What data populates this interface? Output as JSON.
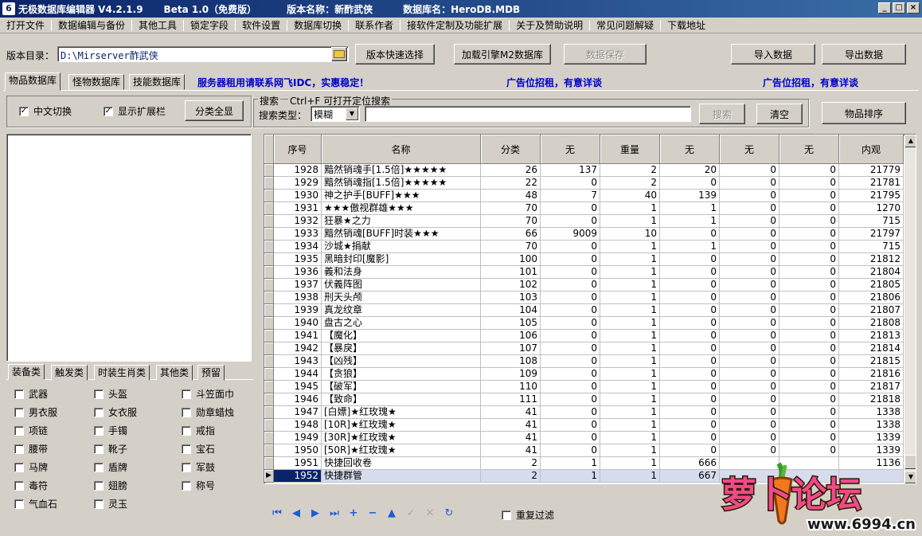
{
  "title_bar": {
    "app": "无极数据库编辑器 V4.2.1.9",
    "edition": "Beta 1.0（免费版）",
    "version_label": "版本名称：新酢武侠",
    "db_label": "数据库名：HeroDB.MDB",
    "buttons": [
      "_",
      "□",
      "×"
    ]
  },
  "menu": [
    "打开文件",
    "数据编辑与备份",
    "其他工具",
    "锁定字段",
    "软件设置",
    "数据库切换",
    "联系作者",
    "接软件定制及功能扩展",
    "关于及赞助说明",
    "常见问题解疑",
    "下载地址"
  ],
  "toolbar": {
    "dir_label": "版本目录：",
    "dir_value": "D:\\Mirserver酢武侠",
    "quick_select": "版本快速选择",
    "load_m2": "加载引擎M2数据库",
    "save": "数据保存",
    "import": "导入数据",
    "export": "导出数据"
  },
  "tabs": [
    "物品数据库",
    "怪物数据库",
    "技能数据库"
  ],
  "ads": {
    "server": "服务器租用请联系网飞IDC，实惠稳定！",
    "ad1": "广告位招租，有意详谈",
    "ad2": "广告位招租，有意详谈"
  },
  "options": {
    "chinese": "中文切换",
    "ext": "显示扩展栏",
    "show_all": "分类全显"
  },
  "search": {
    "title": "搜索",
    "hint": "Ctrl+F 可打开定位搜索",
    "type_label": "搜索类型：",
    "type_value": "模糊",
    "search_btn": "搜索",
    "clear_btn": "清空",
    "sort_btn": "物品排序"
  },
  "category_tabs": [
    "装备类",
    "触发类",
    "时装生肖类",
    "其他类",
    "预留"
  ],
  "categories": [
    "武器",
    "头盔",
    "斗笠面巾",
    "男衣服",
    "女衣服",
    "勋章蜡烛",
    "项链",
    "手镯",
    "戒指",
    "腰带",
    "靴子",
    "宝石",
    "马牌",
    "盾牌",
    "军鼓",
    "毒符",
    "翅膀",
    "称号",
    "气血石",
    "灵玉"
  ],
  "grid": {
    "columns": [
      "序号",
      "名称",
      "分类",
      "无",
      "重量",
      "无",
      "无",
      "无",
      "内观"
    ],
    "rows": [
      [
        "1928",
        "黯然销魂手[1.5倍]★★★★★",
        "26",
        "137",
        "2",
        "20",
        "0",
        "0",
        "21779"
      ],
      [
        "1929",
        "黯然销魂指[1.5倍]★★★★★",
        "22",
        "0",
        "2",
        "0",
        "0",
        "0",
        "21781"
      ],
      [
        "1930",
        "神之护手[BUFF]★★★",
        "48",
        "7",
        "40",
        "139",
        "0",
        "0",
        "21795"
      ],
      [
        "1931",
        "★★★傲视群雄★★★",
        "70",
        "0",
        "1",
        "1",
        "0",
        "0",
        "1270"
      ],
      [
        "1932",
        "狂暴★之力",
        "70",
        "0",
        "1",
        "1",
        "0",
        "0",
        "715"
      ],
      [
        "1933",
        "黯然销魂[BUFF]时装★★★",
        "66",
        "9009",
        "10",
        "0",
        "0",
        "0",
        "21797"
      ],
      [
        "1934",
        "沙城★捐献",
        "70",
        "0",
        "1",
        "1",
        "0",
        "0",
        "715"
      ],
      [
        "1935",
        "黑暗封印[魔影]",
        "100",
        "0",
        "1",
        "0",
        "0",
        "0",
        "21812"
      ],
      [
        "1936",
        "義和法身",
        "101",
        "0",
        "1",
        "0",
        "0",
        "0",
        "21804"
      ],
      [
        "1937",
        "伏義阵图",
        "102",
        "0",
        "1",
        "0",
        "0",
        "0",
        "21805"
      ],
      [
        "1938",
        "刑天头颅",
        "103",
        "0",
        "1",
        "0",
        "0",
        "0",
        "21806"
      ],
      [
        "1939",
        "真龙纹章",
        "104",
        "0",
        "1",
        "0",
        "0",
        "0",
        "21807"
      ],
      [
        "1940",
        "盘古之心",
        "105",
        "0",
        "1",
        "0",
        "0",
        "0",
        "21808"
      ],
      [
        "1941",
        "【魔化】",
        "106",
        "0",
        "1",
        "0",
        "0",
        "0",
        "21813"
      ],
      [
        "1942",
        "【暴戾】",
        "107",
        "0",
        "1",
        "0",
        "0",
        "0",
        "21814"
      ],
      [
        "1943",
        "【凶残】",
        "108",
        "0",
        "1",
        "0",
        "0",
        "0",
        "21815"
      ],
      [
        "1944",
        "【贪狼】",
        "109",
        "0",
        "1",
        "0",
        "0",
        "0",
        "21816"
      ],
      [
        "1945",
        "【破军】",
        "110",
        "0",
        "1",
        "0",
        "0",
        "0",
        "21817"
      ],
      [
        "1946",
        "【致命】",
        "111",
        "0",
        "1",
        "0",
        "0",
        "0",
        "21818"
      ],
      [
        "1947",
        "[白嫖]★红玫瑰★",
        "41",
        "0",
        "1",
        "0",
        "0",
        "0",
        "1338"
      ],
      [
        "1948",
        "[10R]★红玫瑰★",
        "41",
        "0",
        "1",
        "0",
        "0",
        "0",
        "1338"
      ],
      [
        "1949",
        "[30R]★红玫瑰★",
        "41",
        "0",
        "1",
        "0",
        "0",
        "0",
        "1339"
      ],
      [
        "1950",
        "[50R]★红玫瑰★",
        "41",
        "0",
        "1",
        "0",
        "0",
        "0",
        "1339"
      ],
      [
        "1951",
        "快捷回收卷",
        "2",
        "1",
        "1",
        "666",
        "",
        "",
        "1136"
      ],
      [
        "1952",
        "快捷群管",
        "2",
        "1",
        "1",
        "667",
        "",
        "",
        ""
      ]
    ],
    "selected_index": 24
  },
  "nav": {
    "icons": [
      "first-icon",
      "prev-icon",
      "next-icon",
      "last-icon",
      "insert-icon",
      "delete-icon",
      "edit-icon",
      "post-icon",
      "cancel-icon",
      "refresh-icon"
    ],
    "dup_filter": "重复过滤"
  },
  "watermark": {
    "logo_text": "萝卜论坛",
    "url": "www.6994.cn"
  }
}
